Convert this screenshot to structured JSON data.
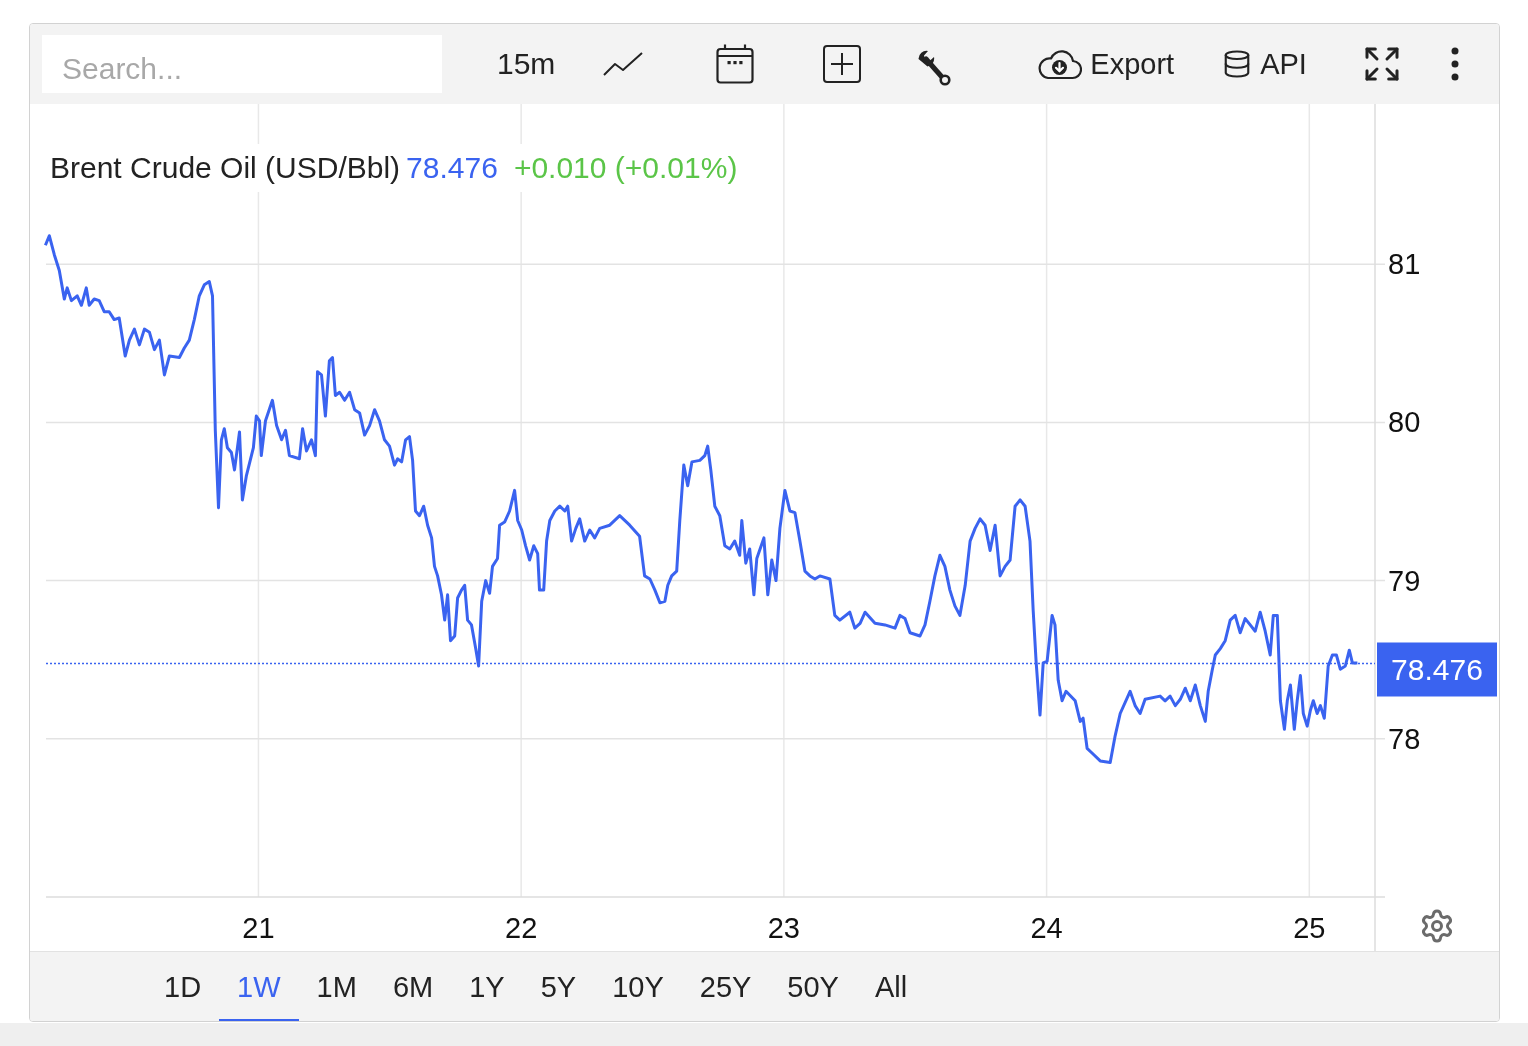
{
  "toolbar": {
    "search": {
      "placeholder": "Search..."
    },
    "interval": "15m",
    "export": "Export",
    "api": "API"
  },
  "chart": {
    "title": "Brent Crude Oil (USD/Bbl)",
    "price": "78.476",
    "change": "+0.010 (+0.01%)",
    "price_badge": "78.476",
    "chart_data": {
      "type": "line",
      "x": [
        20.189,
        20.204,
        20.223,
        20.242,
        20.261,
        20.272,
        20.288,
        20.31,
        20.326,
        20.345,
        20.356,
        20.375,
        20.394,
        20.413,
        20.432,
        20.451,
        20.47,
        20.493,
        20.509,
        20.528,
        20.547,
        20.566,
        20.585,
        20.604,
        20.623,
        20.642,
        20.661,
        20.699,
        20.718,
        20.737,
        20.756,
        20.775,
        20.794,
        20.813,
        20.825,
        20.836,
        20.848,
        20.859,
        20.87,
        20.882,
        20.897,
        20.909,
        20.928,
        20.939,
        20.954,
        20.981,
        20.992,
        21.004,
        21.011,
        21.027,
        21.053,
        21.069,
        21.088,
        21.103,
        21.118,
        21.156,
        21.168,
        21.183,
        21.202,
        21.217,
        21.225,
        21.24,
        21.255,
        21.27,
        21.282,
        21.293,
        21.309,
        21.328,
        21.347,
        21.366,
        21.385,
        21.404,
        21.423,
        21.442,
        21.461,
        21.48,
        21.499,
        21.518,
        21.53,
        21.545,
        21.56,
        21.575,
        21.587,
        21.598,
        21.613,
        21.629,
        21.644,
        21.659,
        21.67,
        21.682,
        21.697,
        21.709,
        21.72,
        21.731,
        21.747,
        21.758,
        21.773,
        21.785,
        21.796,
        21.811,
        21.827,
        21.838,
        21.85,
        21.865,
        21.88,
        21.891,
        21.91,
        21.918,
        21.937,
        21.956,
        21.975,
        21.987,
        22.002,
        22.017,
        22.032,
        22.048,
        22.063,
        22.07,
        22.086,
        22.097,
        22.109,
        22.128,
        22.147,
        22.166,
        22.177,
        22.192,
        22.208,
        22.223,
        22.242,
        22.261,
        22.28,
        22.299,
        22.337,
        22.375,
        22.413,
        22.451,
        22.47,
        22.49,
        22.509,
        22.528,
        22.547,
        22.558,
        22.573,
        22.592,
        22.604,
        22.619,
        22.634,
        22.65,
        22.68,
        22.699,
        22.71,
        22.722,
        22.737,
        22.756,
        22.775,
        22.794,
        22.813,
        22.832,
        22.84,
        22.855,
        22.87,
        22.886,
        22.897,
        22.924,
        22.939,
        22.954,
        22.97,
        22.985,
        23.004,
        23.023,
        23.042,
        23.061,
        23.08,
        23.099,
        23.118,
        23.137,
        23.175,
        23.194,
        23.213,
        23.251,
        23.27,
        23.29,
        23.309,
        23.347,
        23.385,
        23.423,
        23.442,
        23.461,
        23.48,
        23.518,
        23.537,
        23.556,
        23.575,
        23.594,
        23.613,
        23.632,
        23.651,
        23.67,
        23.69,
        23.709,
        23.728,
        23.747,
        23.766,
        23.785,
        23.804,
        23.823,
        23.842,
        23.861,
        23.88,
        23.899,
        23.918,
        23.937,
        23.949,
        23.96,
        23.975,
        23.987,
        24.002,
        24.021,
        24.032,
        24.044,
        24.059,
        24.074,
        24.109,
        24.128,
        24.139,
        24.154,
        24.173,
        24.204,
        24.242,
        24.261,
        24.28,
        24.318,
        24.337,
        24.356,
        24.375,
        24.432,
        24.451,
        24.47,
        24.49,
        24.509,
        24.528,
        24.547,
        24.566,
        24.585,
        24.604,
        24.615,
        24.63,
        24.642,
        24.661,
        24.68,
        24.699,
        24.718,
        24.737,
        24.756,
        24.775,
        24.794,
        24.813,
        24.832,
        24.851,
        24.863,
        24.878,
        24.89,
        24.905,
        24.916,
        24.928,
        24.943,
        24.954,
        24.966,
        24.977,
        24.992,
        25.004,
        25.015,
        25.03,
        25.042,
        25.057,
        25.072,
        25.088,
        25.103,
        25.118,
        25.137,
        25.152,
        25.164,
        25.183
      ],
      "series": [
        {
          "color": "#3a63f0",
          "values": [
            81.12,
            81.18,
            81.06,
            80.96,
            80.78,
            80.85,
            80.77,
            80.8,
            80.74,
            80.85,
            80.74,
            80.78,
            80.77,
            80.7,
            80.7,
            80.65,
            80.66,
            80.42,
            80.52,
            80.59,
            80.49,
            80.59,
            80.57,
            80.46,
            80.52,
            80.3,
            80.42,
            80.41,
            80.47,
            80.52,
            80.65,
            80.8,
            80.87,
            80.89,
            80.8,
            79.95,
            79.46,
            79.89,
            79.96,
            79.84,
            79.81,
            79.7,
            79.94,
            79.51,
            79.66,
            79.84,
            80.04,
            80.01,
            79.79,
            80.01,
            80.14,
            79.98,
            79.89,
            79.95,
            79.79,
            79.77,
            79.96,
            79.82,
            79.89,
            79.79,
            80.32,
            80.3,
            80.04,
            80.39,
            80.41,
            80.17,
            80.19,
            80.14,
            80.19,
            80.08,
            80.06,
            79.92,
            79.98,
            80.08,
            80.01,
            79.89,
            79.85,
            79.73,
            79.77,
            79.75,
            79.89,
            79.91,
            79.76,
            79.44,
            79.41,
            79.47,
            79.35,
            79.27,
            79.09,
            79.03,
            78.91,
            78.75,
            78.91,
            78.62,
            78.65,
            78.89,
            78.94,
            78.97,
            78.75,
            78.72,
            78.57,
            78.46,
            78.87,
            79.0,
            78.92,
            79.09,
            79.14,
            79.35,
            79.37,
            79.44,
            79.57,
            79.38,
            79.32,
            79.22,
            79.13,
            79.22,
            79.17,
            78.94,
            78.94,
            79.25,
            79.38,
            79.44,
            79.47,
            79.44,
            79.47,
            79.25,
            79.33,
            79.39,
            79.25,
            79.32,
            79.27,
            79.33,
            79.35,
            79.41,
            79.35,
            79.28,
            79.03,
            79.01,
            78.94,
            78.86,
            78.87,
            78.97,
            79.03,
            79.06,
            79.38,
            79.73,
            79.6,
            79.75,
            79.76,
            79.79,
            79.85,
            79.7,
            79.47,
            79.41,
            79.22,
            79.2,
            79.25,
            79.16,
            79.38,
            79.11,
            79.2,
            78.91,
            79.14,
            79.27,
            78.91,
            79.13,
            79.0,
            79.33,
            79.57,
            79.44,
            79.43,
            79.25,
            79.06,
            79.03,
            79.01,
            79.03,
            79.01,
            78.78,
            78.75,
            78.8,
            78.7,
            78.73,
            78.8,
            78.73,
            78.72,
            78.7,
            78.78,
            78.76,
            78.67,
            78.65,
            78.72,
            78.87,
            79.03,
            79.16,
            79.09,
            78.94,
            78.84,
            78.78,
            78.97,
            79.25,
            79.33,
            79.39,
            79.35,
            79.19,
            79.35,
            79.03,
            79.09,
            79.13,
            79.47,
            79.51,
            79.47,
            79.25,
            78.81,
            78.49,
            78.15,
            78.48,
            78.49,
            78.78,
            78.72,
            78.37,
            78.24,
            78.3,
            78.24,
            78.11,
            78.13,
            77.94,
            77.91,
            77.86,
            77.85,
            78.02,
            78.16,
            78.3,
            78.21,
            78.16,
            78.25,
            78.27,
            78.24,
            78.27,
            78.21,
            78.25,
            78.32,
            78.24,
            78.34,
            78.21,
            78.11,
            78.3,
            78.43,
            78.53,
            78.57,
            78.62,
            78.75,
            78.78,
            78.67,
            78.76,
            78.72,
            78.68,
            78.8,
            78.68,
            78.53,
            78.78,
            78.78,
            78.24,
            78.06,
            78.24,
            78.34,
            78.06,
            78.24,
            78.4,
            78.16,
            78.08,
            78.18,
            78.24,
            78.16,
            78.21,
            78.13,
            78.46,
            78.53,
            78.53,
            78.44,
            78.46,
            78.56,
            78.48,
            78.48
          ]
        }
      ],
      "xlim": [
        20.18,
        25.25
      ],
      "ylim": [
        77,
        82
      ],
      "xticks": [
        21,
        22,
        23,
        24,
        25
      ],
      "yticks": [
        78,
        79,
        80,
        81
      ],
      "grid": true,
      "ref_lines": [
        {
          "axis": "y",
          "value": 78.476
        }
      ]
    }
  },
  "ranges": [
    {
      "label": "1D",
      "selected": false
    },
    {
      "label": "1W",
      "selected": true
    },
    {
      "label": "1M",
      "selected": false
    },
    {
      "label": "6M",
      "selected": false
    },
    {
      "label": "1Y",
      "selected": false
    },
    {
      "label": "5Y",
      "selected": false
    },
    {
      "label": "10Y",
      "selected": false
    },
    {
      "label": "25Y",
      "selected": false
    },
    {
      "label": "50Y",
      "selected": false
    },
    {
      "label": "All",
      "selected": false
    }
  ]
}
